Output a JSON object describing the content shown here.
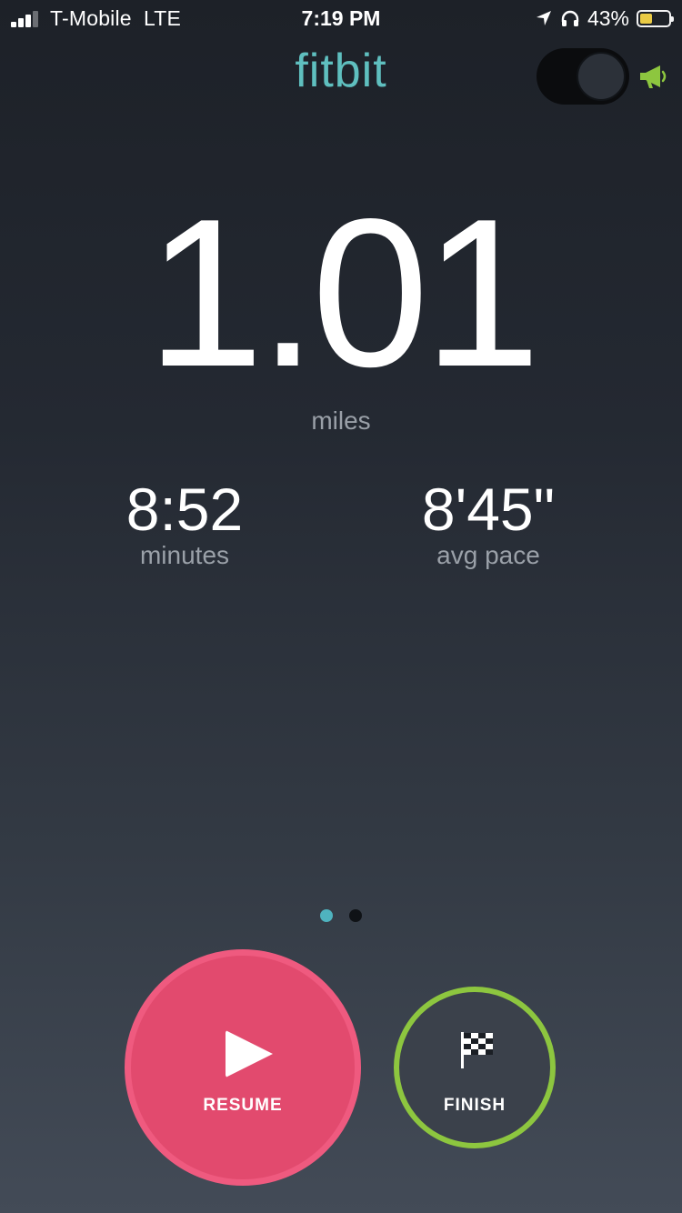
{
  "status_bar": {
    "carrier": "T-Mobile",
    "network": "LTE",
    "time": "7:19 PM",
    "battery_percent": "43%",
    "battery_level": 0.43,
    "battery_color": "#f5d547",
    "icons": [
      "signal-bars-icon",
      "location-arrow-icon",
      "headphones-icon",
      "battery-icon"
    ]
  },
  "header": {
    "logo": "fitbit",
    "logo_color": "#5fbfbf",
    "toggle_state": "on",
    "megaphone_color": "#8dc63f"
  },
  "stats": {
    "distance": "1.01",
    "distance_unit": "miles",
    "duration": "8:52",
    "duration_label": "minutes",
    "pace": "8'45\"",
    "pace_label": "avg pace"
  },
  "pager": {
    "pages": 2,
    "active": 0,
    "active_color": "#4fb3bf",
    "inactive_color": "#0f1216"
  },
  "actions": {
    "resume_label": "RESUME",
    "finish_label": "FINISH",
    "resume_color": "#e24a6e",
    "finish_ring_color": "#8dc63f"
  }
}
